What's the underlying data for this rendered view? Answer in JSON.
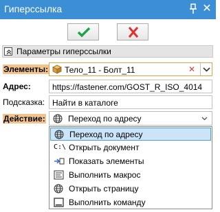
{
  "window": {
    "title": "Гиперссылка"
  },
  "toolbar": {
    "ok_icon": "check-icon",
    "cancel_icon": "cross-icon"
  },
  "section": {
    "title": "Параметры гиперссылки"
  },
  "form": {
    "elements_label": "Элементы:",
    "elements_value": "Тело_11 - Болт_11",
    "address_label": "Адрес:",
    "address_value": "https://fastener.com/GOST_R_ISO_4014",
    "hint_label": "Подсказка:",
    "hint_value": "Найти в каталоге",
    "action_label": "Действие:",
    "action_value": "Переход по адресу"
  },
  "dropdown": {
    "options": [
      {
        "label": "Переход по адресу",
        "icon": "globe-icon"
      },
      {
        "label": "Открыть документ",
        "icon": "path-icon"
      },
      {
        "label": "Показать элементы",
        "icon": "show-elements-icon"
      },
      {
        "label": "Выполнить макрос",
        "icon": "macro-icon"
      },
      {
        "label": "Открыть страницу",
        "icon": "page-icon"
      },
      {
        "label": "Выполнить команду",
        "icon": "command-icon"
      }
    ],
    "selected_index": 0
  },
  "colors": {
    "titlebar": "#3c8fd4",
    "highlight_label": "#f2c48d",
    "selected_option": "#cce4f7",
    "ok": "#1aa34a",
    "cancel": "#e03030"
  }
}
